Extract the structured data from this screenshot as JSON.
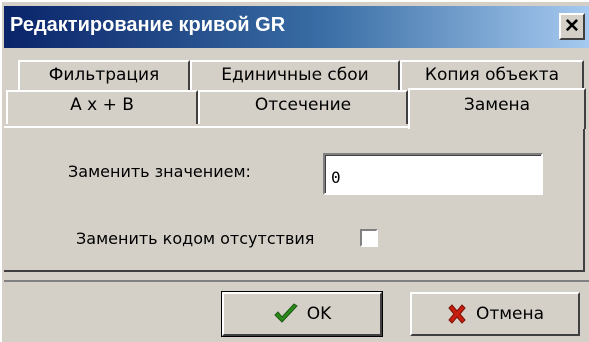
{
  "window": {
    "title": "Редактирование кривой GR",
    "close_label": "✕"
  },
  "tabs_row1": [
    {
      "label": "Фильтрация"
    },
    {
      "label": "Единичные сбои"
    },
    {
      "label": "Копия объекта"
    }
  ],
  "tabs_row2": [
    {
      "label": "A x + B"
    },
    {
      "label": "Отсечение"
    },
    {
      "label": "Замена",
      "active": true
    }
  ],
  "panel": {
    "replace_value_label": "Заменить значением:",
    "replace_value": "0",
    "replace_missing_label": "Заменить кодом отсутствия",
    "replace_missing_checked": false
  },
  "buttons": {
    "ok_label": "OK",
    "ok_icon": "check-icon",
    "ok_icon_color": "#2a8a1a",
    "cancel_label": "Отмена",
    "cancel_icon": "x-icon",
    "cancel_icon_color": "#c81e0f"
  }
}
